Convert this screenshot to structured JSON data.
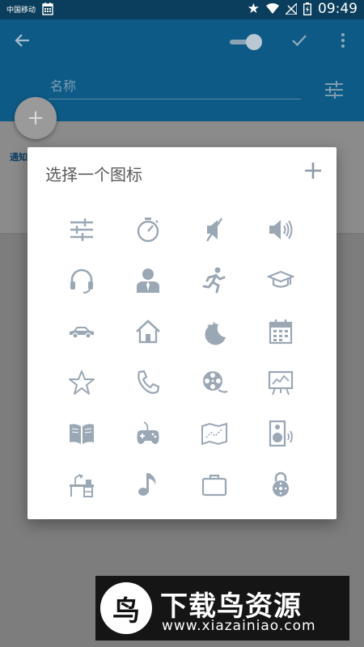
{
  "status": {
    "carrier": "中国移动",
    "time": "09:49"
  },
  "appbar": {
    "name_placeholder": "名称"
  },
  "fab": {
    "label": "+"
  },
  "background": {
    "label": "通知"
  },
  "dialog": {
    "title": "选择一个图标",
    "icons": [
      "sliders-icon",
      "stopwatch-icon",
      "mute-icon",
      "volume-icon",
      "headset-icon",
      "person-icon",
      "running-icon",
      "graduation-cap-icon",
      "car-icon",
      "home-icon",
      "moon-stars-icon",
      "calendar-icon",
      "star-icon",
      "phone-icon",
      "film-reel-icon",
      "presentation-icon",
      "book-icon",
      "gamepad-icon",
      "map-icon",
      "speaker-icon",
      "desk-icon",
      "music-note-icon",
      "briefcase-icon",
      "padlock-icon"
    ]
  },
  "watermark": {
    "logo_text": "鸟",
    "name": "下载鸟资源",
    "url": "www.xiazainiao.com"
  },
  "colors": {
    "appbar": "#0d5a86",
    "statusbar": "#0b3e5c",
    "icon": "#9aa7b4"
  }
}
